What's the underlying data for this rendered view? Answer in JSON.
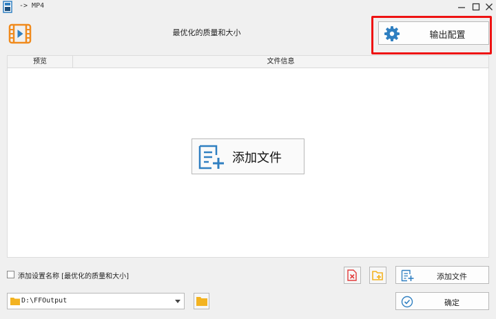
{
  "window": {
    "title": "-> MP4"
  },
  "header": {
    "preset_name": "最优化的质量和大小",
    "output_config_label": "输出配置"
  },
  "table": {
    "columns": [
      "预览",
      "文件信息"
    ]
  },
  "center": {
    "add_file_label": "添加文件"
  },
  "footer": {
    "save_preset_label": "添加设置名称 [最优化的质量和大小]",
    "save_preset_checked": false,
    "add_file_label": "添加文件",
    "output_path": "D:\\FFOutput",
    "ok_label": "确定"
  },
  "colors": {
    "accent_blue": "#2f7fc1",
    "orange": "#f08a1c",
    "red_highlight": "#ee1111",
    "clear_red": "#e23b3b",
    "folder_yellow": "#f3b321"
  },
  "icons": [
    "app-icon",
    "minimize-icon",
    "maximize-icon",
    "close-icon",
    "video-logo-icon",
    "gear-icon",
    "add-file-icon",
    "clear-list-icon",
    "add-folder-icon",
    "folder-icon",
    "chevron-down-icon",
    "check-circle-icon"
  ]
}
